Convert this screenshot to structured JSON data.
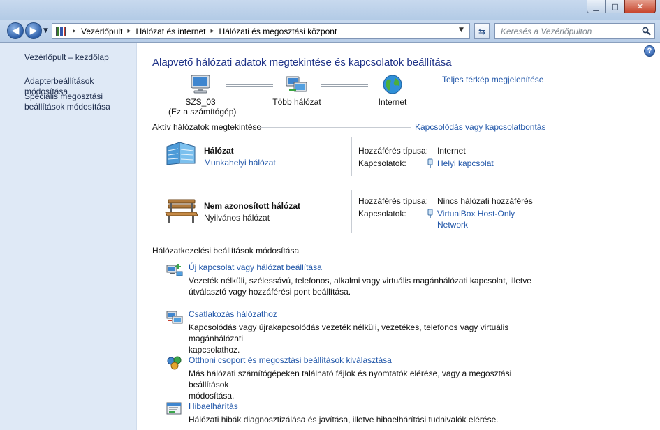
{
  "window": {
    "minimize": "▁",
    "maximize": "□",
    "close": "✕"
  },
  "navigation": {
    "back_icon": "◀",
    "forward_icon": "▶",
    "breadcrumb": [
      "Vezérlőpult",
      "Hálózat és internet",
      "Hálózati és megosztási központ"
    ],
    "search_placeholder": "Keresés a Vezérlőpulton"
  },
  "sidebar": {
    "items": [
      {
        "label": "Vezérlőpult – kezdőlap"
      },
      {
        "label": "Adapterbeállítások módosítása"
      },
      {
        "label": "Speciális megosztási beállítások módosítása",
        "line1": "Speciális megosztási",
        "line2": "beállítások módosítása"
      }
    ]
  },
  "main": {
    "title": "Alapvető hálózati adatok megtekintése és kapcsolatok beállítása",
    "full_map_link": "Teljes térkép megjelenítése",
    "map": {
      "computer_name": "SZS_03",
      "computer_sub": "(Ez a számítógép)",
      "network_label": "Több hálózat",
      "internet_label": "Internet"
    },
    "active_section_title": "Aktív hálózatok megtekintése",
    "connect_link": "Kapcsolódás vagy kapcsolatbontás",
    "networks": [
      {
        "name": "Hálózat",
        "type": "Munkahelyi hálózat",
        "access_label": "Hozzáférés típusa:",
        "access_value": "Internet",
        "connections_label": "Kapcsolatok:",
        "connection_line1": "Helyi kapcsolat",
        "connection_line2": ""
      },
      {
        "name": "Nem azonosított hálózat",
        "type": "Nyilvános hálózat",
        "access_label": "Hozzáférés típusa:",
        "access_value": "Nincs hálózati hozzáférés",
        "connections_label": "Kapcsolatok:",
        "connection_line1": "VirtualBox Host-Only",
        "connection_line2": "Network"
      }
    ],
    "settings_section_title": "Hálózatkezelési beállítások módosítása",
    "tasks": [
      {
        "title": "Új kapcsolat vagy hálózat beállítása",
        "desc_line1": "Vezeték nélküli, szélessávú, telefonos, alkalmi vagy virtuális magánhálózati kapcsolat, illetve",
        "desc_line2": "útválasztó vagy hozzáférési pont beállítása."
      },
      {
        "title": "Csatlakozás hálózathoz",
        "desc_line1": "Kapcsolódás vagy újrakapcsolódás vezeték nélküli, vezetékes, telefonos vagy virtuális magánhálózati",
        "desc_line2": "kapcsolathoz."
      },
      {
        "title": "Otthoni csoport és megosztási beállítások kiválasztása",
        "desc_line1": "Más hálózati számítógépeken található fájlok és nyomtatók elérése, vagy a megosztási beállítások",
        "desc_line2": "módosítása."
      },
      {
        "title": "Hibaelhárítás",
        "desc_line1": "Hálózati hibák diagnosztizálása és javítása, illetve hibaelhárítási tudnivalók elérése.",
        "desc_line2": ""
      }
    ]
  },
  "colors": {
    "link": "#1f55a8",
    "title": "#1e3287",
    "sidebar_bg": "#dfe9f6"
  }
}
